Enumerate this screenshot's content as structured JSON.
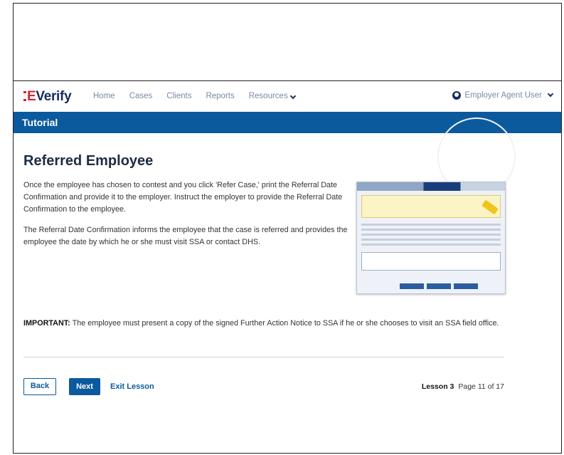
{
  "header": {
    "logo_prefix": "E",
    "logo_text": "Verify",
    "nav": [
      "Home",
      "Cases",
      "Clients",
      "Reports",
      "Resources"
    ],
    "user": "Employer Agent User"
  },
  "tutorial": {
    "label": "Tutorial"
  },
  "page": {
    "title": "Referred Employee",
    "paragraph1": "Once the employee has chosen to contest and you click 'Refer Case,' print the Referral Date Confirmation and provide it to the employer. Instruct the employer to provide the Referral Date Confirmation to the employee.",
    "paragraph2": "The Referral Date Confirmation informs the employee that the case is referred and provides the employee the date by which he or she must visit SSA or contact DHS.",
    "important_label": "IMPORTANT:",
    "important_text": " The employee must present a copy of the signed Further Action Notice to SSA if he or she chooses to visit an SSA field office."
  },
  "footer": {
    "back": "Back",
    "next": "Next",
    "exit": "Exit Lesson",
    "lesson": "Lesson 3",
    "page": "Page 11 of 17"
  },
  "icons": {
    "user": "user-circle-icon",
    "chevron": "chevron-down-icon"
  },
  "colors": {
    "brand_blue": "#0b5a9e",
    "logo_red": "#d22630",
    "logo_navy": "#1a2b5e"
  }
}
